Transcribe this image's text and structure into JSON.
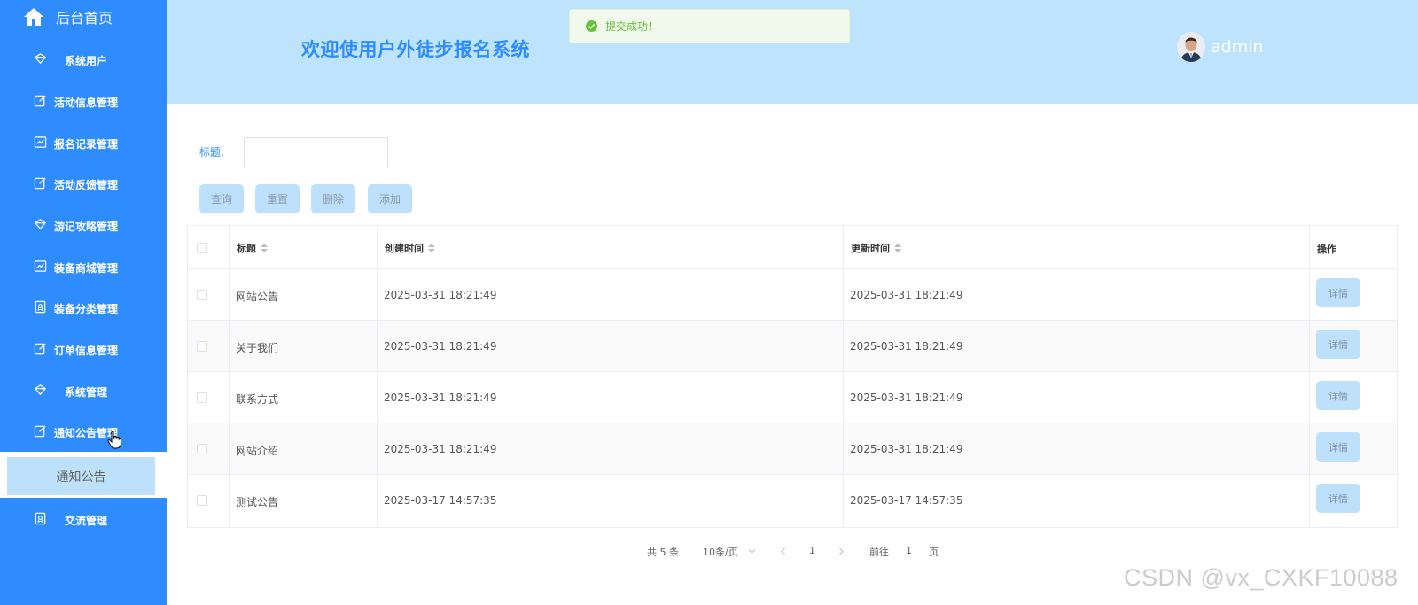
{
  "sidebar": {
    "home_label": "后台首页",
    "items": [
      {
        "label": "系统用户",
        "icon": "diamond-icon"
      },
      {
        "label": "活动信息管理",
        "icon": "edit-icon"
      },
      {
        "label": "报名记录管理",
        "icon": "chart-icon"
      },
      {
        "label": "活动反馈管理",
        "icon": "edit-icon"
      },
      {
        "label": "游记攻略管理",
        "icon": "diamond-icon"
      },
      {
        "label": "装备商城管理",
        "icon": "chart-icon"
      },
      {
        "label": "装备分类管理",
        "icon": "badge-icon"
      },
      {
        "label": "订单信息管理",
        "icon": "edit-icon"
      },
      {
        "label": "系统管理",
        "icon": "diamond-icon"
      },
      {
        "label": "通知公告管理",
        "icon": "edit-icon"
      },
      {
        "label": "交流管理",
        "icon": "badge-icon"
      }
    ],
    "submenu_active": "通知公告"
  },
  "header": {
    "welcome": "欢迎使用户外徒步报名系统",
    "user": "admin"
  },
  "toast": {
    "message": "提交成功!",
    "color": "#67c23a"
  },
  "search": {
    "title_label": "标题:",
    "title_value": ""
  },
  "toolbar": {
    "query": "查询",
    "reset": "重置",
    "delete": "删除",
    "add": "添加"
  },
  "table": {
    "headers": {
      "title": "标题",
      "created": "创建时间",
      "updated": "更新时间",
      "actions": "操作"
    },
    "detail_label": "详情",
    "rows": [
      {
        "title": "网站公告",
        "created": "2025-03-31 18:21:49",
        "updated": "2025-03-31 18:21:49"
      },
      {
        "title": "关于我们",
        "created": "2025-03-31 18:21:49",
        "updated": "2025-03-31 18:21:49"
      },
      {
        "title": "联系方式",
        "created": "2025-03-31 18:21:49",
        "updated": "2025-03-31 18:21:49"
      },
      {
        "title": "网站介绍",
        "created": "2025-03-31 18:21:49",
        "updated": "2025-03-31 18:21:49"
      },
      {
        "title": "测试公告",
        "created": "2025-03-17 14:57:35",
        "updated": "2025-03-17 14:57:35"
      }
    ]
  },
  "pagination": {
    "total": "共 5 条",
    "page_size": "10条/页",
    "current_page": "1",
    "goto_prefix": "前往",
    "goto_value": "1",
    "goto_suffix": "页"
  },
  "watermark": "CSDN @vx_CXKF10088",
  "colors": {
    "sidebar": "#2f8cff",
    "header": "#bde3fd",
    "accent": "#2f8cff",
    "button": "#bde0fb"
  }
}
